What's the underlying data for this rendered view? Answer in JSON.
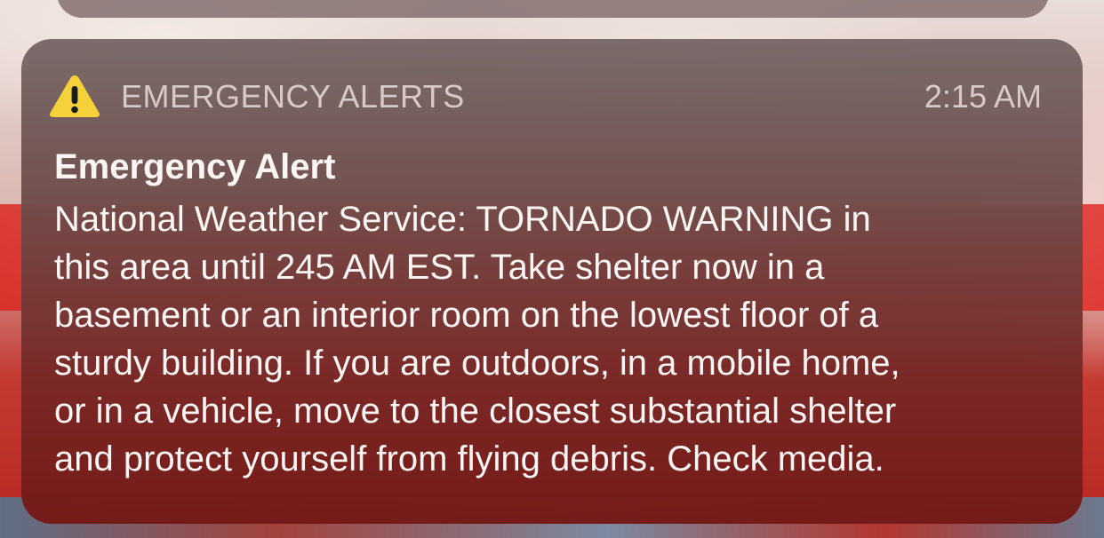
{
  "notification": {
    "app_name": "EMERGENCY ALERTS",
    "time": "2:15 AM",
    "icon": "warning-triangle-icon",
    "title": "Emergency Alert",
    "body_lines": [
      "National Weather Service: TORNADO WARNING in",
      "this area until 245 AM EST. Take shelter now in a",
      "basement or an interior room on the lowest floor of a",
      "sturdy building. If you are outdoors, in a mobile home,",
      "or in a vehicle, move to the closest substantial shelter",
      "and protect yourself from flying debris. Check media."
    ]
  },
  "colors": {
    "icon_fill": "#f5d23a",
    "header_text": "#d6cac8",
    "body_text": "#fbf5f4"
  }
}
